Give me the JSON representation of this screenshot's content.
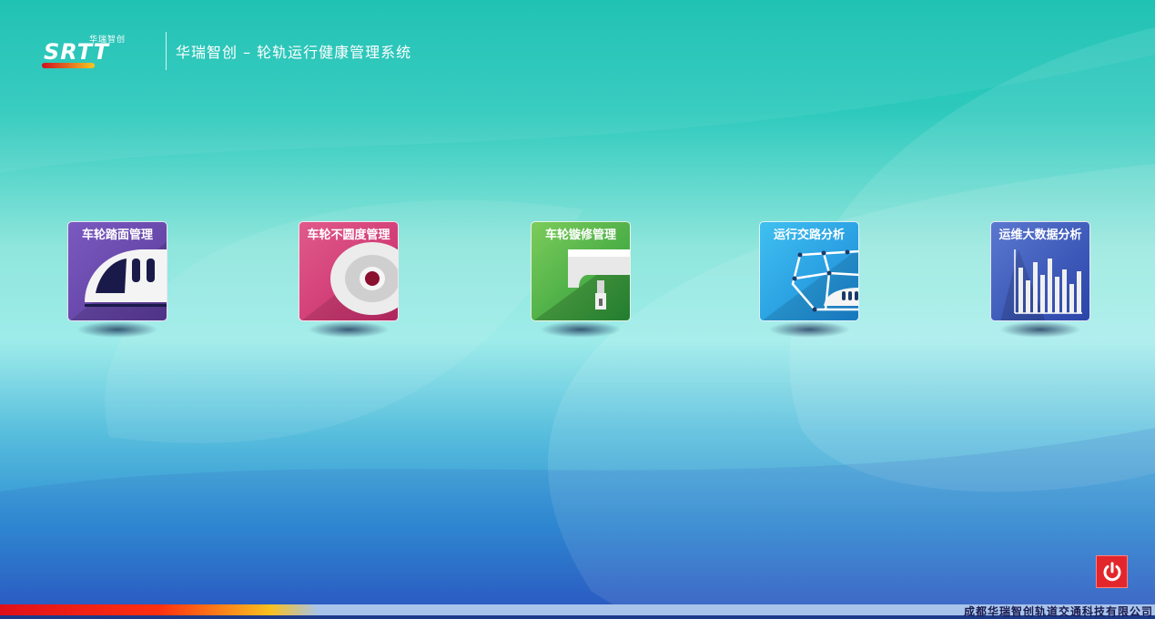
{
  "header": {
    "logo_cn": "华瑞智创",
    "logo_text": "SRTT",
    "title": "华瑞智创 – 轮轨运行健康管理系统"
  },
  "tiles": [
    {
      "label": "车轮踏面管理",
      "icon": "train-icon",
      "color": "#6a4aa8"
    },
    {
      "label": "车轮不圆度管理",
      "icon": "wheel-icon",
      "color": "#d63a7a"
    },
    {
      "label": "车轮镟修管理",
      "icon": "lathe-icon",
      "color": "#3aa050"
    },
    {
      "label": "运行交路分析",
      "icon": "route-map-icon",
      "color": "#2a9ee0"
    },
    {
      "label": "运维大数据分析",
      "icon": "bar-chart-icon",
      "color": "#3a50b0"
    }
  ],
  "footer": {
    "company": "成都华瑞智创轨道交通科技有限公司"
  },
  "power_icon": "power-icon"
}
